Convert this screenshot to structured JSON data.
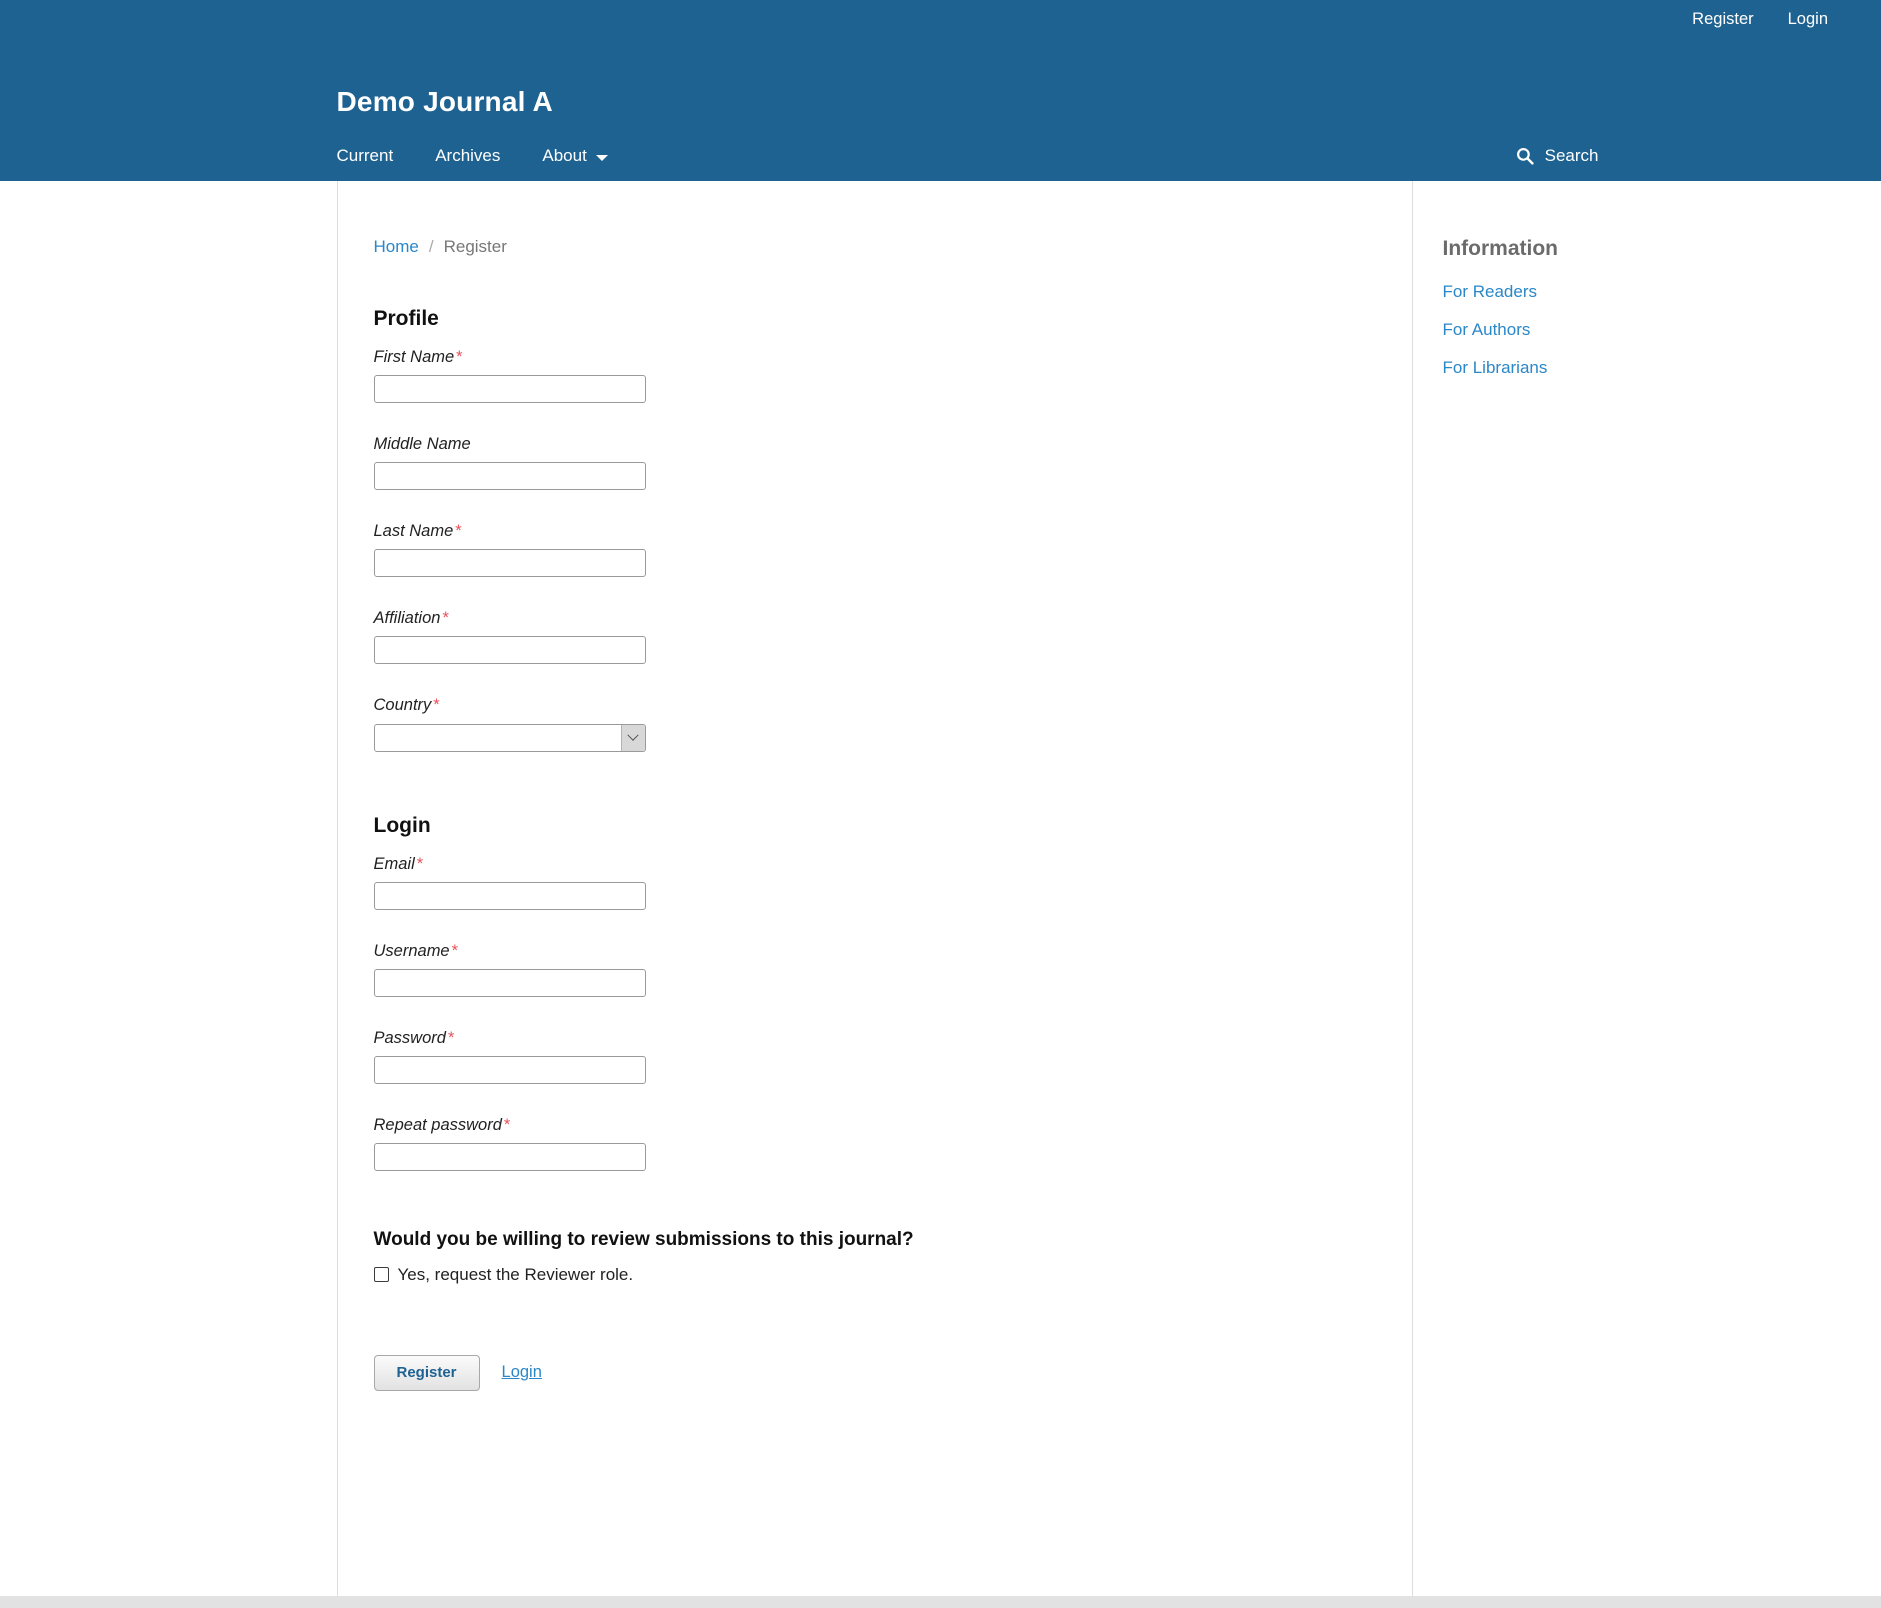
{
  "header": {
    "site_title": "Demo Journal A",
    "user_nav": [
      {
        "label": "Register",
        "name": "register"
      },
      {
        "label": "Login",
        "name": "login"
      }
    ],
    "main_nav": [
      {
        "label": "Current",
        "name": "current",
        "has_caret": false
      },
      {
        "label": "Archives",
        "name": "archives",
        "has_caret": false
      },
      {
        "label": "About",
        "name": "about",
        "has_caret": true
      }
    ],
    "search_label": "Search",
    "search_icon": "search-icon",
    "brand_color": "#1e6292"
  },
  "breadcrumb": {
    "home": "Home",
    "separator": "/",
    "current": "Register"
  },
  "profile": {
    "heading": "Profile",
    "fields": [
      {
        "label": "First Name",
        "required": true,
        "type": "text",
        "value": "",
        "name": "first-name"
      },
      {
        "label": "Middle Name",
        "required": false,
        "type": "text",
        "value": "",
        "name": "middle-name"
      },
      {
        "label": "Last Name",
        "required": true,
        "type": "text",
        "value": "",
        "name": "last-name"
      },
      {
        "label": "Affiliation",
        "required": true,
        "type": "text",
        "value": "",
        "name": "affiliation"
      },
      {
        "label": "Country",
        "required": true,
        "type": "select",
        "value": "",
        "name": "country"
      }
    ],
    "country_selected": "",
    "required_marker": "*"
  },
  "login_section": {
    "heading": "Login",
    "fields": [
      {
        "label": "Email",
        "required": true,
        "type": "email",
        "value": "",
        "name": "email"
      },
      {
        "label": "Username",
        "required": true,
        "type": "text",
        "value": "",
        "name": "username"
      },
      {
        "label": "Password",
        "required": true,
        "type": "password",
        "value": "",
        "name": "password"
      },
      {
        "label": "Repeat password",
        "required": true,
        "type": "password",
        "value": "",
        "name": "repeat-password"
      }
    ]
  },
  "reviewer": {
    "question": "Would you be willing to review submissions to this journal?",
    "checkbox_label": "Yes, request the Reviewer role.",
    "checked": false
  },
  "actions": {
    "register_label": "Register",
    "login_label": "Login"
  },
  "sidebar": {
    "title": "Information",
    "links": [
      {
        "label": "For Readers",
        "name": "for-readers"
      },
      {
        "label": "For Authors",
        "name": "for-authors"
      },
      {
        "label": "For Librarians",
        "name": "for-librarians"
      }
    ]
  }
}
